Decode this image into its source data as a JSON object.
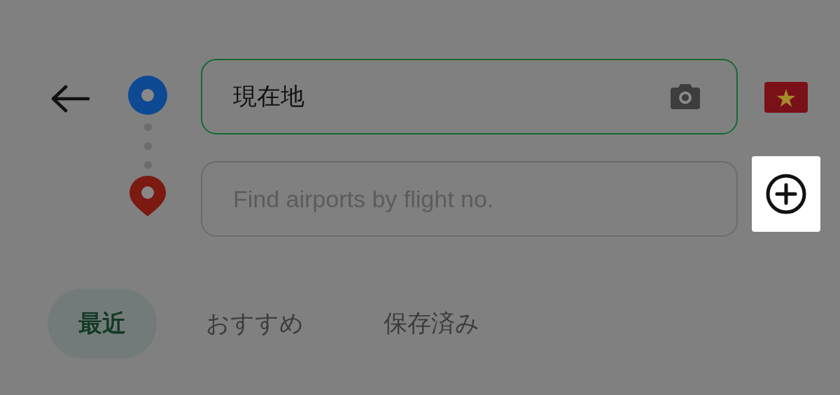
{
  "route": {
    "from": {
      "value": "現在地"
    },
    "to": {
      "placeholder": "Find airports by flight no."
    },
    "add_button": {
      "highlighted": true
    }
  },
  "tabs": [
    {
      "label": "最近",
      "selected": true
    },
    {
      "label": "おすすめ",
      "selected": false
    },
    {
      "label": "保存済み",
      "selected": false
    }
  ]
}
